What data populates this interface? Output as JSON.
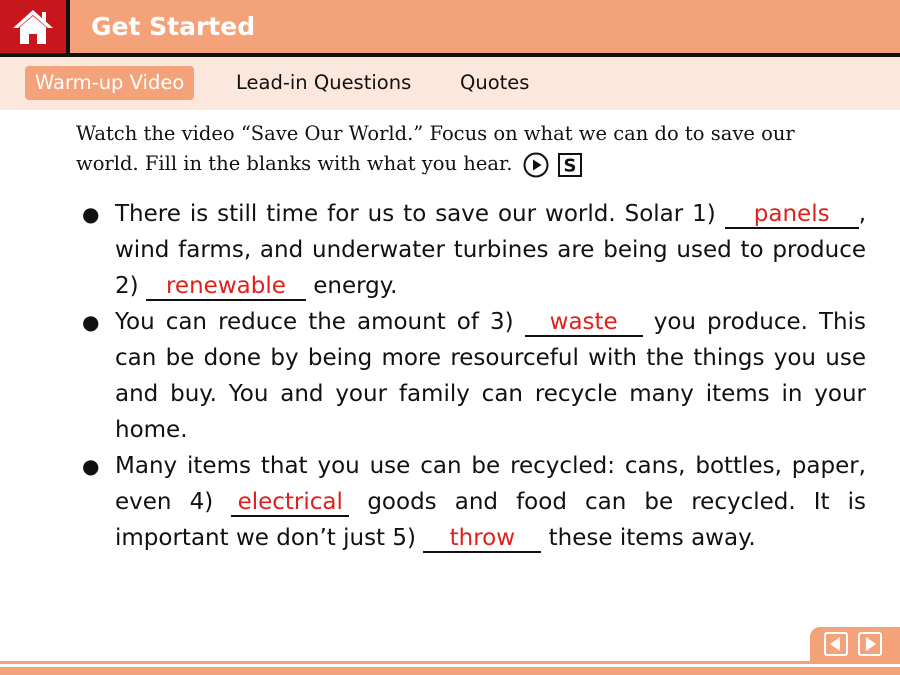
{
  "header": {
    "title": "Get Started"
  },
  "tabs": [
    {
      "label": "Warm-up Video",
      "active": true
    },
    {
      "label": "Lead-in Questions",
      "active": false
    },
    {
      "label": "Quotes",
      "active": false
    }
  ],
  "instruction": {
    "line1": "Watch the video “Save Our World.” Focus on what we can do to save our",
    "line2": "world. Fill in the blanks with what you hear.",
    "play_icon": "play-circle-icon",
    "script_icon": "script-s-icon"
  },
  "bullets": {
    "b1": {
      "t1": "There is still time for us to save our world. Solar 1) ",
      "a1": "panels",
      "t2": ", wind farms, and underwater turbines are being used to produce 2) ",
      "a2": "renewable",
      "t3": " energy."
    },
    "b2": {
      "t1": "You can reduce the amount of 3) ",
      "a1": "waste",
      "t2": " you produce. This can be done by being more resourceful with the things you use and buy. You and your family can recycle many items in your home."
    },
    "b3": {
      "t1": "Many items that you use can be recycled: cans, bottles, paper, even 4) ",
      "a1": "electrical",
      "t2": " goods and food can be recycled. It is important we don’t just 5) ",
      "a2": "throw",
      "t3": " these items away."
    }
  },
  "colors": {
    "accent": "#f3a27a",
    "home_red": "#c8161d",
    "tab_bg": "#fbe7dc",
    "answer": "#e0201b"
  },
  "nav": {
    "prev_icon": "prev-arrow-icon",
    "next_icon": "next-arrow-icon"
  }
}
